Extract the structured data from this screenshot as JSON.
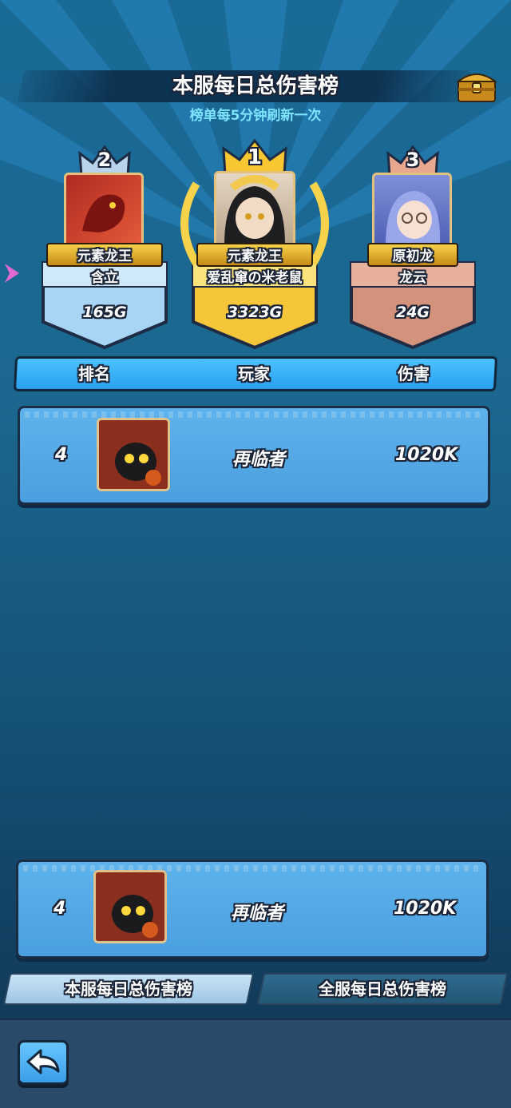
{
  "header": {
    "title": "本服每日总伤害榜",
    "subtitle": "榜单每5分钟刷新一次"
  },
  "podium": [
    {
      "rank": "2",
      "title": "元素龙王",
      "player": "含立",
      "damage": "165G",
      "color": "#8ec9f3"
    },
    {
      "rank": "1",
      "title": "元素龙王",
      "player": "爱乱窜の米老鼠",
      "damage": "3323G",
      "color": "#f5c53a"
    },
    {
      "rank": "3",
      "title": "原初龙",
      "player": "龙云",
      "damage": "24G",
      "color": "#d99a86"
    }
  ],
  "table_header": {
    "rank_label": "排名",
    "player_label": "玩家",
    "damage_label": "伤害"
  },
  "rows": [
    {
      "rank": "4",
      "player": "再临者",
      "damage": "1020K"
    }
  ],
  "my_row": {
    "rank": "4",
    "player": "再临者",
    "damage": "1020K"
  },
  "tabs": [
    {
      "label": "本服每日总伤害榜",
      "active": true
    },
    {
      "label": "全服每日总伤害榜",
      "active": false
    }
  ],
  "icons": {
    "chest": "treasure-chest-icon",
    "back": "back-arrow-icon"
  }
}
